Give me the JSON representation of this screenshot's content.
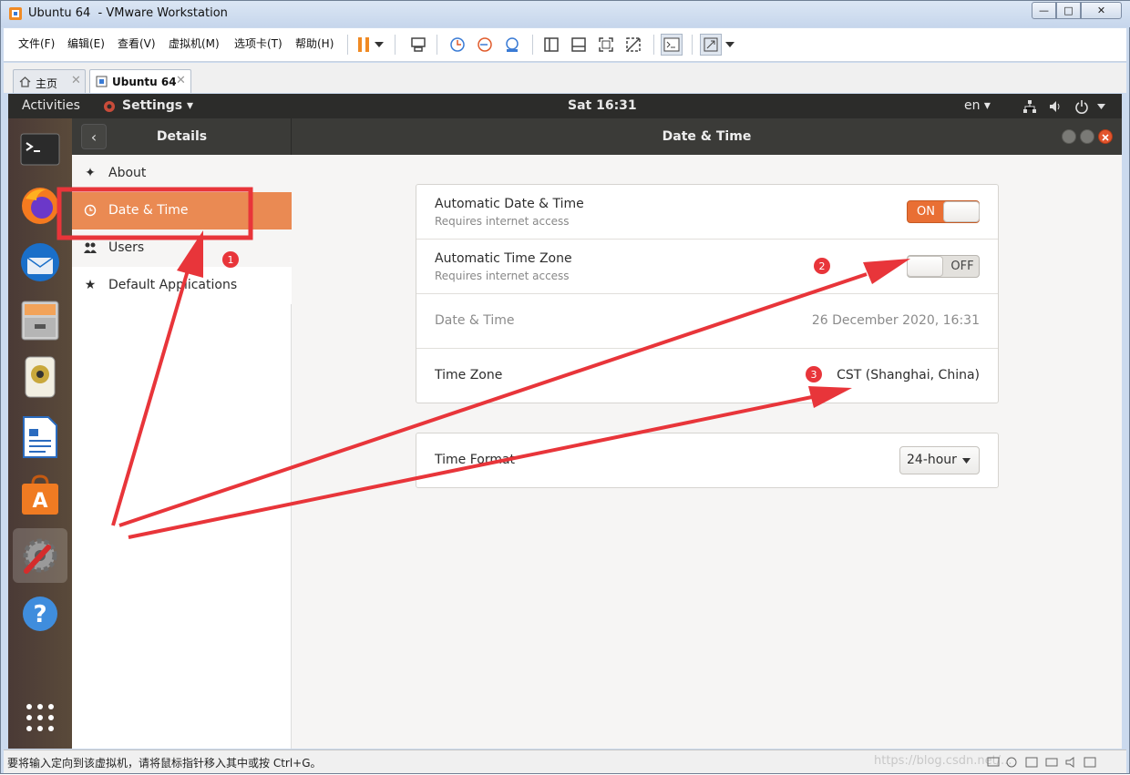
{
  "window": {
    "title": "Ubuntu 64  - VMware Workstation",
    "controls": {
      "minimize": "—",
      "maximize": "□",
      "close": "✕"
    }
  },
  "menubar": {
    "items": [
      "文件(F)",
      "编辑(E)",
      "查看(V)",
      "虚拟机(M)",
      "选项卡(T)",
      "帮助(H)"
    ]
  },
  "toolbar": {
    "icons": [
      "pause-icon",
      "dropdown-arrow-icon",
      "send-ctrl-alt-del-icon",
      "snapshot-icon",
      "revert-snapshot-icon",
      "snapshot-manager-icon",
      "library-view-icon",
      "thumbnail-bar-icon",
      "full-screen-icon",
      "unity-icon",
      "console-view-icon",
      "stretch-guest-icon",
      "dropdown-arrow-icon"
    ]
  },
  "tabs": [
    {
      "label": "主页",
      "close": "✕"
    },
    {
      "label": "Ubuntu 64",
      "close": "✕"
    }
  ],
  "ubuntu": {
    "topbar": {
      "activities": "Activities",
      "app_menu": "Settings ▾",
      "clock": "Sat 16:31",
      "lang": "en ▾",
      "tray": [
        "network-icon",
        "volume-icon",
        "power-icon"
      ]
    },
    "dock": [
      "terminal",
      "firefox",
      "thunderbird",
      "files",
      "rhythmbox",
      "libreoffice-writer",
      "ubuntu-software",
      "settings",
      "help",
      "show-applications"
    ],
    "header": {
      "back": "‹",
      "sidebar_title": "Details",
      "panel_title": "Date & Time"
    },
    "sidebar": {
      "items": [
        {
          "label": "About",
          "icon": "star-sparkle-icon"
        },
        {
          "label": "Date & Time",
          "icon": "clock-icon",
          "selected": true
        },
        {
          "label": "Users",
          "icon": "users-icon"
        },
        {
          "label": "Default Applications",
          "icon": "star-icon"
        }
      ]
    },
    "datetime": {
      "auto_datetime": {
        "title": "Automatic Date & Time",
        "subtitle": "Requires internet access",
        "state": "ON"
      },
      "auto_timezone": {
        "title": "Automatic Time Zone",
        "subtitle": "Requires internet access",
        "state": "OFF"
      },
      "date_time": {
        "title": "Date & Time",
        "value": "26 December 2020, 16:31"
      },
      "time_zone": {
        "title": "Time Zone",
        "value": "CST (Shanghai, China)"
      },
      "time_format": {
        "title": "Time Format",
        "value": "24-hour"
      }
    }
  },
  "statusbar": {
    "text": "要将输入定向到该虚拟机，请将鼠标指针移入其中或按 Ctrl+G。",
    "watermark": "https://blog.csdn.net/..."
  },
  "annotations": {
    "markers": [
      "1",
      "2",
      "3"
    ],
    "color": "#e8353a"
  },
  "colors": {
    "accent": "#ea8a53",
    "annotation": "#e8353a",
    "topbar": "#2c2c2a"
  }
}
